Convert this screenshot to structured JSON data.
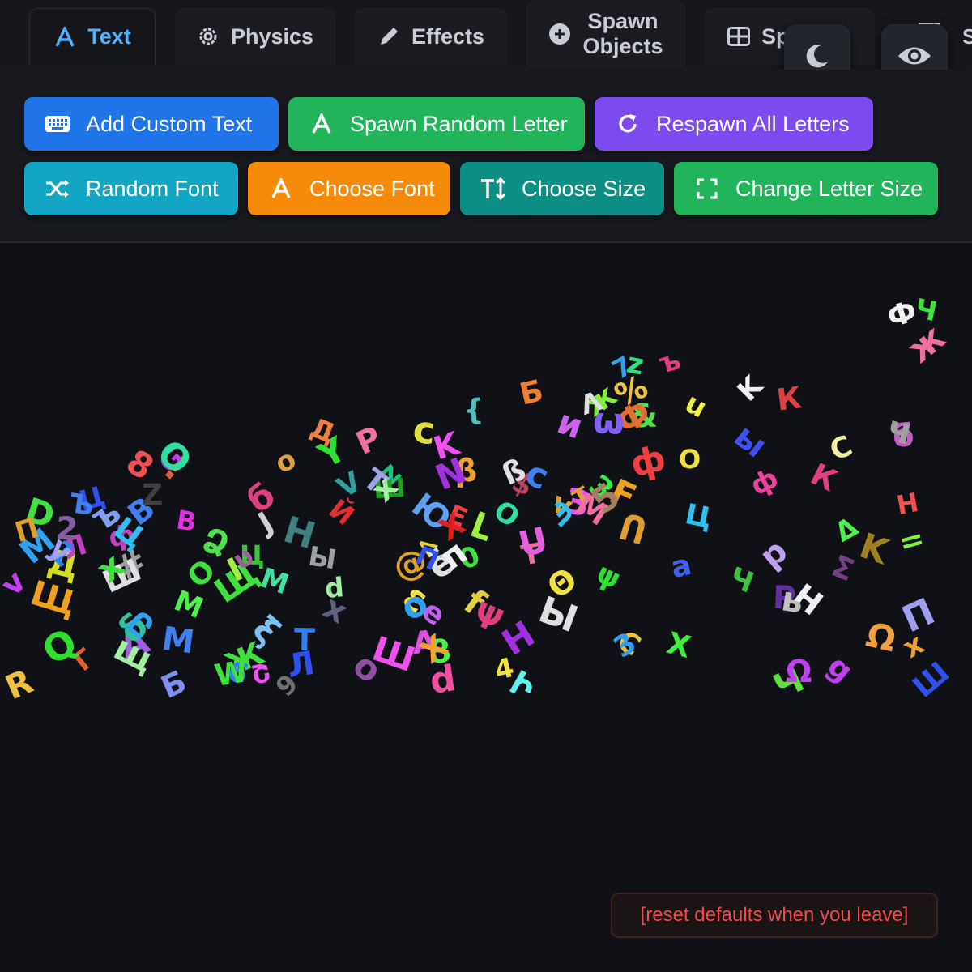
{
  "tabs": [
    {
      "label": "Text",
      "icon": "text-a-icon",
      "active": true
    },
    {
      "label": "Physics",
      "icon": "atom-gear-icon",
      "active": false
    },
    {
      "label": "Effects",
      "icon": "pencil-icon",
      "active": false
    },
    {
      "label_line1": "Spawn",
      "label_line2": "Objects",
      "icon": "plus-circle-icon",
      "active": false
    },
    {
      "label": "Spawn...",
      "icon": "table-icon",
      "active": false
    }
  ],
  "toolbar_icons": [
    "moon-icon",
    "eye-icon",
    "broken-image-icon"
  ],
  "actions": [
    {
      "label": "Add Custom Text",
      "icon": "keyboard-icon",
      "color": "#1f74e8"
    },
    {
      "label": "Spawn Random Letter",
      "icon": "letter-a-icon",
      "color": "#22b45a"
    },
    {
      "label": "Respawn All Letters",
      "icon": "refresh-icon",
      "color": "#7b4bf0"
    },
    {
      "label": "Random Font",
      "icon": "shuffle-icon",
      "color": "#12a5c4"
    },
    {
      "label": "Choose Font",
      "icon": "letter-a-icon",
      "color": "#f58a0b"
    },
    {
      "label": "Choose Size",
      "icon": "text-size-icon",
      "color": "#0d8f86"
    },
    {
      "label": "Change Letter Size",
      "icon": "expand-icon",
      "color": "#22b45a"
    }
  ],
  "letters": [
    {
      "c": "0",
      "col": "#3fe03f"
    },
    {
      "c": "<",
      "col": "#e0d040"
    },
    {
      "c": "v",
      "col": "#e0a030"
    },
    {
      "c": "%",
      "col": "#f0c040"
    },
    {
      "c": "&",
      "col": "#50e050"
    },
    {
      "c": "!",
      "col": "#e06040"
    },
    {
      "c": "#",
      "col": "#a0a0a0"
    },
    {
      "c": "@",
      "col": "#e0a020"
    },
    {
      "c": "Б",
      "col": "#8090f0"
    },
    {
      "c": "$",
      "col": "#c04060"
    },
    {
      "c": "Й",
      "col": "#e03030"
    },
    {
      "c": "Ж",
      "col": "#40e040"
    },
    {
      "c": "З",
      "col": "#f050f0"
    },
    {
      "c": "В",
      "col": "#4080f0"
    },
    {
      "c": "Д",
      "col": "#d0e020"
    },
    {
      "c": "б",
      "col": "#c060c0"
    },
    {
      "c": "A",
      "col": "#e050e0"
    },
    {
      "c": "б",
      "col": "#e04080"
    },
    {
      "c": "ξ",
      "col": "#80c0f0"
    },
    {
      "c": "Ω",
      "col": "#f0a040"
    },
    {
      "c": "Б",
      "col": "#f08030"
    },
    {
      "c": "Ձ",
      "col": "#50e050"
    },
    {
      "c": "Շ",
      "col": "#f050f0"
    },
    {
      "c": "Պ",
      "col": "#30c0f0"
    },
    {
      "c": "Յ",
      "col": "#50f050"
    },
    {
      "c": "A",
      "col": "#a060e0"
    },
    {
      "c": "D",
      "col": "#40e040"
    },
    {
      "c": "C",
      "col": "#f0c040"
    },
    {
      "c": "G",
      "col": "#c040f0"
    },
    {
      "c": "H",
      "col": "#a030e0"
    },
    {
      "c": "{",
      "col": "#50c0c0"
    },
    {
      "c": "Л",
      "col": "#c040c0"
    },
    {
      "c": "K",
      "col": "#f0f0f0"
    },
    {
      "c": "ж",
      "col": "#80f040"
    },
    {
      "c": "Е",
      "col": "#f04040"
    },
    {
      "c": "e",
      "col": "#c060f0"
    },
    {
      "c": "а",
      "col": "#4060f0"
    },
    {
      "c": "Г",
      "col": "#e06030"
    },
    {
      "c": "В",
      "col": "#e030e0"
    },
    {
      "c": "Ю",
      "col": "#60a0f0"
    },
    {
      "c": "Օ",
      "col": "#30e0a0"
    },
    {
      "c": "Ո",
      "col": "#e0a030"
    },
    {
      "c": "d",
      "col": "#f050a0"
    },
    {
      "c": "f",
      "col": "#e0d040"
    },
    {
      "c": "Ի",
      "col": "#60f0f0"
    },
    {
      "c": "c",
      "col": "#e0e040"
    },
    {
      "c": "F",
      "col": "#f0a020"
    },
    {
      "c": "Լ",
      "col": "#a0f040"
    },
    {
      "c": "1",
      "col": "#3080f0"
    },
    {
      "c": "Ф",
      "col": "#e07030"
    },
    {
      "c": "О",
      "col": "#40e040"
    },
    {
      "c": "Н",
      "col": "#f05050"
    },
    {
      "c": "М",
      "col": "#50f050"
    },
    {
      "c": "Л",
      "col": "#3050f0"
    },
    {
      "c": "К",
      "col": "#e04040"
    },
    {
      "c": "Δ",
      "col": "#50f050"
    },
    {
      "c": "β",
      "col": "#f0a030"
    },
    {
      "c": "Д",
      "col": "#f08040"
    },
    {
      "c": "ё",
      "col": "#e0e0e0"
    },
    {
      "c": "z",
      "col": "#20c080"
    },
    {
      "c": "δ",
      "col": "#30c0a0"
    },
    {
      "c": "ß",
      "col": "#e0e0e0"
    },
    {
      "c": "Ц",
      "col": "#30c0f0"
    },
    {
      "c": "g",
      "col": "#c040f0"
    },
    {
      "c": "ф",
      "col": "#f040a0"
    },
    {
      "c": "Ը",
      "col": "#30a0f0"
    },
    {
      "c": "J",
      "col": "#d0d0d0"
    },
    {
      "c": "K",
      "col": "#a08020"
    },
    {
      "c": "М",
      "col": "#40e0a0"
    },
    {
      "c": "=",
      "col": "#80f040"
    },
    {
      "c": "T",
      "col": "#f070a0"
    },
    {
      "c": "Р",
      "col": "#6030a0"
    },
    {
      "c": "т",
      "col": "#e0a040"
    },
    {
      "c": "o",
      "col": "#9050a0"
    },
    {
      "c": "Х",
      "col": "#f0a030"
    },
    {
      "c": "С",
      "col": "#f0f0a0"
    },
    {
      "c": "у",
      "col": "#a0a0f0"
    },
    {
      "c": "р",
      "col": "#c0a0f0"
    },
    {
      "c": "K",
      "col": "#f050f0"
    },
    {
      "c": "І",
      "col": "#a0f040"
    },
    {
      "c": "Θ",
      "col": "#f0e040"
    },
    {
      "c": "v",
      "col": "#c040f0"
    },
    {
      "c": "Λ",
      "col": "#e0e0e0"
    },
    {
      "c": "ε",
      "col": "#f0e040"
    },
    {
      "c": "O",
      "col": "#30e0a0"
    },
    {
      "c": "Н",
      "col": "#f0f0f0"
    },
    {
      "c": "М",
      "col": "#30a0f0"
    },
    {
      "c": "З",
      "col": "#30f040"
    },
    {
      "c": "и",
      "col": "#d060f0"
    },
    {
      "c": "П",
      "col": "#e0a030"
    },
    {
      "c": "2",
      "col": "#8060a0"
    },
    {
      "c": "4",
      "col": "#f0e040"
    },
    {
      "c": "Ц",
      "col": "#3050f0"
    },
    {
      "c": "ф",
      "col": "#c040c0"
    },
    {
      "c": "Т",
      "col": "#3080f0"
    },
    {
      "c": "Σ",
      "col": "#704080"
    },
    {
      "c": "N",
      "col": "#a030e0"
    },
    {
      "c": "М",
      "col": "#f070a0"
    },
    {
      "c": "Ш",
      "col": "#e0e0e0"
    },
    {
      "c": "Ч",
      "col": "#40c040"
    },
    {
      "c": "х",
      "col": "#40e040"
    },
    {
      "c": "Ш",
      "col": "#20a020"
    },
    {
      "c": "О",
      "col": "#f0e040"
    },
    {
      "c": "П",
      "col": "#3050f0"
    },
    {
      "c": "о",
      "col": "#30a0f0"
    },
    {
      "c": "П",
      "col": "#a0a0f0"
    },
    {
      "c": "Н",
      "col": "#408080"
    },
    {
      "c": "К",
      "col": "#e04080"
    },
    {
      "c": "М",
      "col": "#4080f0"
    },
    {
      "c": "d",
      "col": "#a0f0a0"
    },
    {
      "c": "P",
      "col": "#f070a0"
    },
    {
      "c": "R",
      "col": "#f0c040"
    },
    {
      "c": "6",
      "col": "#3080f0"
    },
    {
      "c": "5",
      "col": "#a08060"
    },
    {
      "c": "8",
      "col": "#f05050"
    },
    {
      "c": "7",
      "col": "#30a0f0"
    },
    {
      "c": "9",
      "col": "#707070"
    },
    {
      "c": "Щ",
      "col": "#40e040"
    },
    {
      "c": "Ц",
      "col": "#40c040"
    },
    {
      "c": "Щ",
      "col": "#f0a020"
    },
    {
      "c": "ч",
      "col": "#a0a0a0"
    },
    {
      "c": "ъ",
      "col": "#e04080"
    },
    {
      "c": "Ψ",
      "col": "#e04080"
    },
    {
      "c": "х",
      "col": "#f0a030"
    },
    {
      "c": "ф",
      "col": "#f04040"
    },
    {
      "c": "Т",
      "col": "#a0a0f0"
    },
    {
      "c": "Ф",
      "col": "#f0f0f0"
    },
    {
      "c": "Ч",
      "col": "#60e040"
    },
    {
      "c": "х",
      "col": "#606080"
    },
    {
      "c": "с",
      "col": "#4080f0"
    },
    {
      "c": "ь",
      "col": "#c0c0c0"
    },
    {
      "c": "Q",
      "col": "#30e030"
    },
    {
      "c": "X",
      "col": "#e02020"
    },
    {
      "c": "V",
      "col": "#30a0a0"
    },
    {
      "c": "Z",
      "col": "#404040"
    },
    {
      "c": "Y",
      "col": "#30e030"
    },
    {
      "c": "Ъ",
      "col": "#4080f0"
    },
    {
      "c": "Ы",
      "col": "#a0a0a0"
    },
    {
      "c": "Ω",
      "col": "#c040f0"
    },
    {
      "c": "ω",
      "col": "#8060f0"
    },
    {
      "c": "υ",
      "col": "#a060a0"
    },
    {
      "c": "ψ",
      "col": "#30e030"
    },
    {
      "c": "Х",
      "col": "#40f040"
    },
    {
      "c": "Ы",
      "col": "#e0e0e0"
    },
    {
      "c": "Ш",
      "col": "#f050f0"
    },
    {
      "c": "Ч",
      "col": "#40e040"
    },
    {
      "c": "Ш",
      "col": "#3050f0"
    },
    {
      "c": "ы",
      "col": "#4050f0"
    },
    {
      "c": "ъ",
      "col": "#80a0f0"
    },
    {
      "c": "щ",
      "col": "#a0f0a0"
    },
    {
      "c": "п",
      "col": "#f0f0f0"
    },
    {
      "c": "u",
      "col": "#f0f040"
    },
    {
      "c": "z",
      "col": "#30e080"
    },
    {
      "c": "Ц",
      "col": "#30c0f0"
    },
    {
      "c": "U",
      "col": "#e060e0"
    },
    {
      "c": "o",
      "col": "#e0a040"
    },
    {
      "c": "x",
      "col": "#a0f0a0"
    },
    {
      "c": "W",
      "col": "#40e040"
    },
    {
      "c": "3",
      "col": "#30a0f0"
    },
    {
      "c": "ж",
      "col": "#f070a0"
    }
  ],
  "reset_notice": "[reset defaults when you leave]"
}
